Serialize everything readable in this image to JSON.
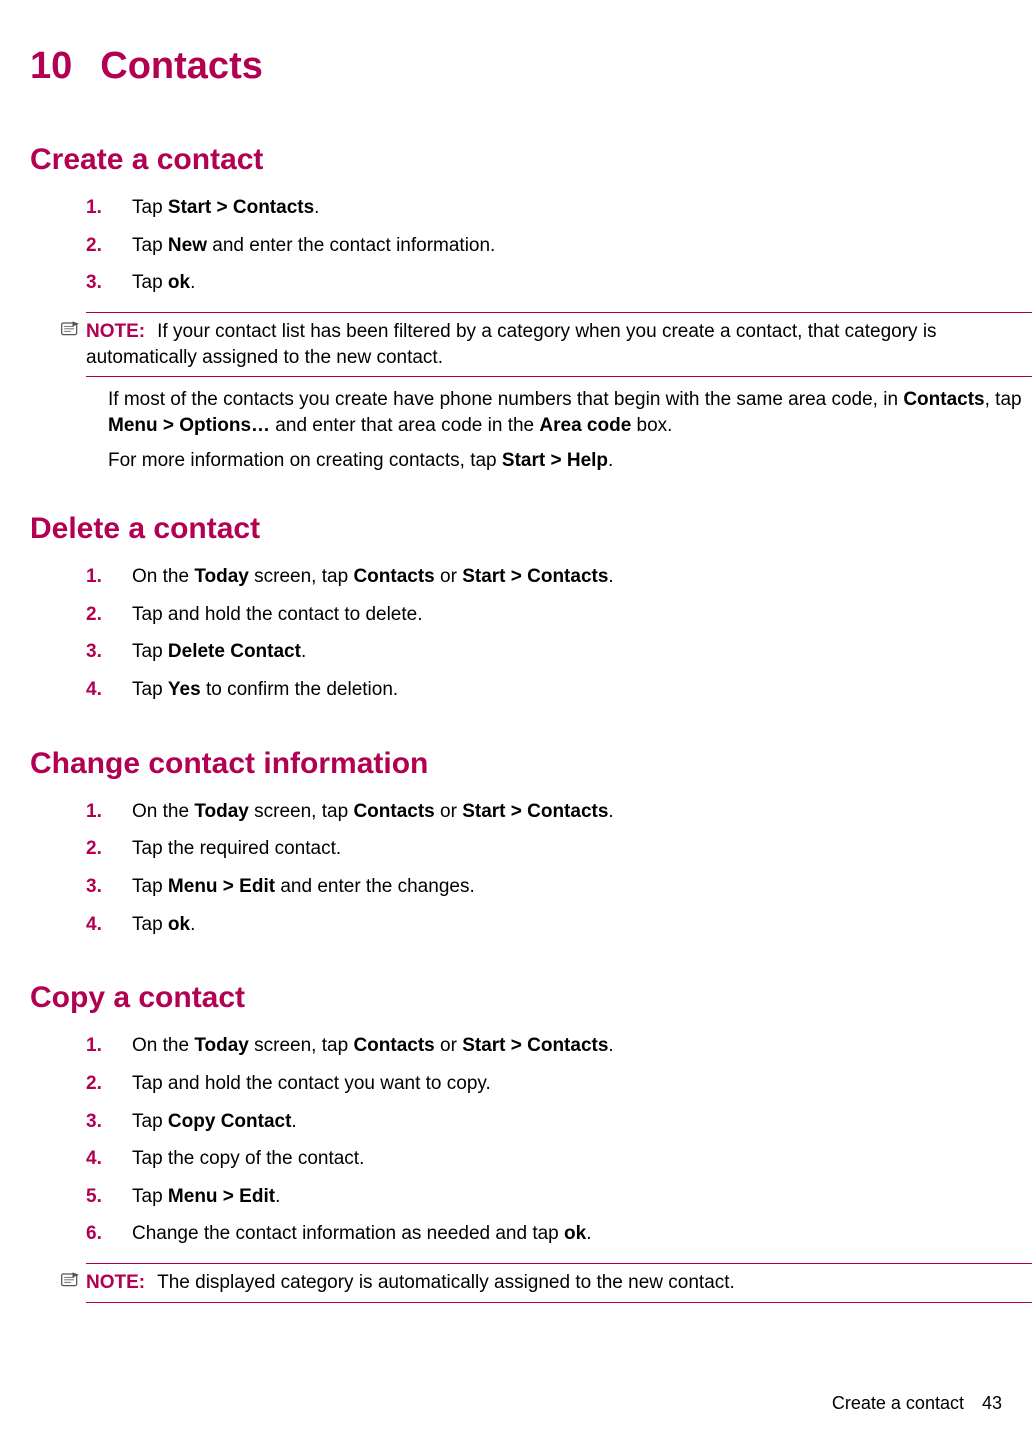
{
  "chapter": {
    "number": "10",
    "title": "Contacts"
  },
  "sections": {
    "create": {
      "heading": "Create a contact",
      "steps": [
        {
          "n": "1.",
          "pre": "Tap ",
          "b1": "Start > Contacts",
          "post": "."
        },
        {
          "n": "2.",
          "pre": "Tap ",
          "b1": "New",
          "mid": " and enter the contact information."
        },
        {
          "n": "3.",
          "pre": "Tap ",
          "b1": "ok",
          "post": "."
        }
      ],
      "note": {
        "label": "NOTE:",
        "text": "If your contact list has been filtered by a category when you create a contact, that category is automatically assigned to the new contact."
      },
      "para1": {
        "p1": "If most of the contacts you create have phone numbers that begin with the same area code, in ",
        "b1": "Contacts",
        "p2": ", tap ",
        "b2": "Menu > Options…",
        "p3": " and enter that area code in the ",
        "b3": "Area code",
        "p4": " box."
      },
      "para2": {
        "p1": "For more information on creating contacts, tap ",
        "b1": "Start > Help",
        "p2": "."
      }
    },
    "delete": {
      "heading": "Delete a contact",
      "steps": [
        {
          "n": "1.",
          "pre": "On the ",
          "b1": "Today",
          "mid": " screen, tap ",
          "b2": "Contacts",
          "mid2": " or ",
          "b3": "Start > Contacts",
          "post": "."
        },
        {
          "n": "2.",
          "pre": "Tap and hold the contact to delete."
        },
        {
          "n": "3.",
          "pre": "Tap ",
          "b1": "Delete Contact",
          "post": "."
        },
        {
          "n": "4.",
          "pre": "Tap ",
          "b1": "Yes",
          "mid": " to confirm the deletion."
        }
      ]
    },
    "change": {
      "heading": "Change contact information",
      "steps": [
        {
          "n": "1.",
          "pre": "On the ",
          "b1": "Today",
          "mid": " screen, tap ",
          "b2": "Contacts",
          "mid2": " or ",
          "b3": "Start > Contacts",
          "post": "."
        },
        {
          "n": "2.",
          "pre": "Tap the required contact."
        },
        {
          "n": "3.",
          "pre": "Tap ",
          "b1": "Menu > Edit",
          "mid": " and enter the changes."
        },
        {
          "n": "4.",
          "pre": "Tap ",
          "b1": "ok",
          "post": "."
        }
      ]
    },
    "copy": {
      "heading": "Copy a contact",
      "steps": [
        {
          "n": "1.",
          "pre": "On the ",
          "b1": "Today",
          "mid": " screen, tap ",
          "b2": "Contacts",
          "mid2": " or ",
          "b3": "Start > Contacts",
          "post": "."
        },
        {
          "n": "2.",
          "pre": "Tap and hold the contact you want to copy."
        },
        {
          "n": "3.",
          "pre": "Tap ",
          "b1": "Copy Contact",
          "post": "."
        },
        {
          "n": "4.",
          "pre": "Tap the copy of the contact."
        },
        {
          "n": "5.",
          "pre": "Tap ",
          "b1": "Menu > Edit",
          "post": "."
        },
        {
          "n": "6.",
          "pre": "Change the contact information as needed and tap ",
          "b1": "ok",
          "post": "."
        }
      ],
      "note": {
        "label": "NOTE:",
        "text": "The displayed category is automatically assigned to the new contact."
      }
    }
  },
  "footer": {
    "section": "Create a contact",
    "page": "43"
  }
}
